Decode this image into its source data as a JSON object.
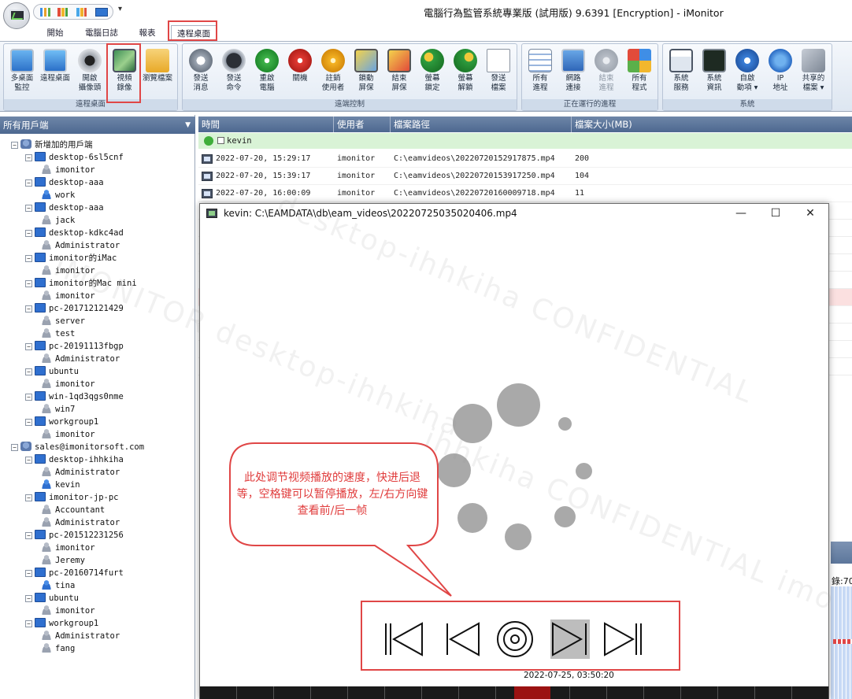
{
  "window": {
    "title": "電腦行為監管系統專業版 (試用版) 9.6391 [Encryption] - iMonitor"
  },
  "ribbon_tabs": [
    "開始",
    "電腦日誌",
    "報表",
    "遠程桌面"
  ],
  "ribbon_groups": [
    {
      "label": "遠程桌面",
      "buttons": [
        "多桌面\n監控",
        "遠程桌面",
        "開啟\n攝像頭",
        "視頻\n錄像",
        "瀏覽檔案"
      ]
    },
    {
      "label": "遠端控制",
      "buttons": [
        "發送\n消息",
        "發送\n命令",
        "重啟\n電腦",
        "關機",
        "註銷\n使用者",
        "鎖動\n屏保",
        "結束\n屏保",
        "螢幕\n鎖定",
        "螢幕\n解鎖",
        "發送\n檔案"
      ]
    },
    {
      "label": "正在運行的進程",
      "buttons": [
        "所有\n進程",
        "網路\n連接",
        "結束\n進程",
        "所有\n程式"
      ]
    },
    {
      "label": "系統",
      "buttons": [
        "系統\n服務",
        "系統\n資訊",
        "自啟\n動項 ▾",
        "IP\n地址",
        "共享的\n檔案 ▾"
      ]
    }
  ],
  "left_pane": {
    "header": "所有用戶端",
    "tree": [
      {
        "label": "新增加的用戶端",
        "type": "group",
        "level": 0
      },
      {
        "label": "desktop-6sl5cnf",
        "type": "pc",
        "level": 1
      },
      {
        "label": "imonitor",
        "type": "user",
        "level": 2
      },
      {
        "label": "desktop-aaa",
        "type": "pc",
        "level": 1
      },
      {
        "label": "work",
        "type": "user-on",
        "level": 2
      },
      {
        "label": "desktop-aaa",
        "type": "pc",
        "level": 1
      },
      {
        "label": "jack",
        "type": "user",
        "level": 2
      },
      {
        "label": "desktop-kdkc4ad",
        "type": "pc",
        "level": 1
      },
      {
        "label": "Administrator",
        "type": "user",
        "level": 2
      },
      {
        "label": "imonitor的iMac",
        "type": "pc",
        "level": 1
      },
      {
        "label": "imonitor",
        "type": "user",
        "level": 2
      },
      {
        "label": "imonitor的Mac mini",
        "type": "pc",
        "level": 1
      },
      {
        "label": "imonitor",
        "type": "user",
        "level": 2
      },
      {
        "label": "pc-201712121429",
        "type": "pc",
        "level": 1
      },
      {
        "label": "server",
        "type": "user",
        "level": 2
      },
      {
        "label": "test",
        "type": "user",
        "level": 2
      },
      {
        "label": "pc-20191113fbgp",
        "type": "pc",
        "level": 1
      },
      {
        "label": "Administrator",
        "type": "user",
        "level": 2
      },
      {
        "label": "ubuntu",
        "type": "pc",
        "level": 1
      },
      {
        "label": "imonitor",
        "type": "user",
        "level": 2
      },
      {
        "label": "win-1qd3qgs0nme",
        "type": "pc",
        "level": 1
      },
      {
        "label": "win7",
        "type": "user",
        "level": 2
      },
      {
        "label": "workgroup1",
        "type": "pc",
        "level": 1
      },
      {
        "label": "imonitor",
        "type": "user",
        "level": 2
      },
      {
        "label": "sales@imonitorsoft.com",
        "type": "group",
        "level": 0
      },
      {
        "label": "desktop-ihhkiha",
        "type": "pc",
        "level": 1
      },
      {
        "label": "Administrator",
        "type": "user",
        "level": 2
      },
      {
        "label": "kevin",
        "type": "user-on",
        "level": 2
      },
      {
        "label": "imonitor-jp-pc",
        "type": "pc",
        "level": 1
      },
      {
        "label": "Accountant",
        "type": "user",
        "level": 2
      },
      {
        "label": "Administrator",
        "type": "user",
        "level": 2
      },
      {
        "label": "pc-201512231256",
        "type": "pc",
        "level": 1
      },
      {
        "label": "imonitor",
        "type": "user",
        "level": 2
      },
      {
        "label": "Jeremy",
        "type": "user",
        "level": 2
      },
      {
        "label": "pc-20160714furt",
        "type": "pc",
        "level": 1
      },
      {
        "label": "tina",
        "type": "user-on",
        "level": 2
      },
      {
        "label": "ubuntu",
        "type": "pc",
        "level": 1
      },
      {
        "label": "imonitor",
        "type": "user",
        "level": 2
      },
      {
        "label": "workgroup1",
        "type": "pc",
        "level": 1
      },
      {
        "label": "Administrator",
        "type": "user",
        "level": 2
      },
      {
        "label": "fang",
        "type": "user",
        "level": 2
      }
    ]
  },
  "table": {
    "columns": [
      "時間",
      "使用者",
      "檔案路徑",
      "檔案大小(MB)"
    ],
    "group_row": "kevin",
    "rows": [
      {
        "time": "2022-07-20, 15:29:17",
        "user": "imonitor",
        "path": "C:\\eamvideos\\20220720152917875.mp4",
        "size": "200"
      },
      {
        "time": "2022-07-20, 15:39:17",
        "user": "imonitor",
        "path": "C:\\eamvideos\\20220720153917250.mp4",
        "size": "104"
      },
      {
        "time": "2022-07-20, 16:00:09",
        "user": "imonitor",
        "path": "C:\\eamvideos\\20220720160009718.mp4",
        "size": "11"
      }
    ]
  },
  "player": {
    "title": "kevin: C:\\EAMDATA\\db\\eam_videos\\20220725035020406.mp4",
    "minimize": "—",
    "maximize": "☐",
    "close": "✕",
    "callout_text": "此处调节视频播放的速度，快进后退等，空格键可以暂停播放，左/右方向键查看前/后一帧",
    "timestamp": "2022-07-25, 03:50:20",
    "progress": 0.5
  },
  "edge": {
    "partial_text": "錄:70"
  },
  "colors": {
    "accent_red": "#e04646",
    "header_blue": "#4d6890",
    "group_green": "#d9f3d6"
  }
}
